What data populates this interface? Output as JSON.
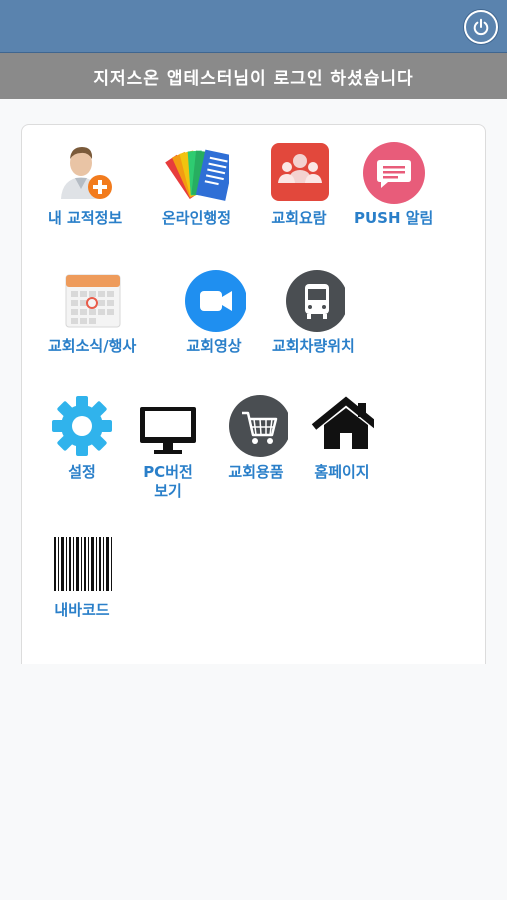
{
  "header": {
    "power_icon": "power-icon",
    "accent": "#5a83ae"
  },
  "banner": {
    "text": "지저스온 앱테스터님이 로그인 하셨습니다"
  },
  "menu": [
    {
      "label": "내 교적정보",
      "icon": "add-user-icon"
    },
    {
      "label": "온라인행정",
      "icon": "documents-icon"
    },
    {
      "label": "교회요람",
      "icon": "group-icon"
    },
    {
      "label": "PUSH 알림",
      "icon": "message-icon"
    },
    {
      "label": "교회소식/행사",
      "icon": "calendar-icon"
    },
    {
      "label": "교회영상",
      "icon": "video-icon"
    },
    {
      "label": "교회차량위치",
      "icon": "bus-icon"
    },
    {
      "label": "설정",
      "icon": "gear-icon"
    },
    {
      "label": "PC버전 보기",
      "icon": "monitor-icon"
    },
    {
      "label": "교회용품",
      "icon": "cart-icon"
    },
    {
      "label": "홈페이지",
      "icon": "home-icon"
    },
    {
      "label": "내바코드",
      "icon": "barcode-icon"
    }
  ]
}
